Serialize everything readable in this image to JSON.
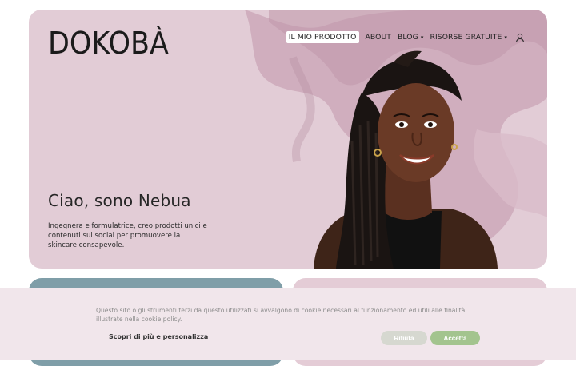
{
  "brand": {
    "logo": "DOKOBÀ"
  },
  "nav": {
    "items": [
      {
        "label": "IL MIO PRODOTTO",
        "active": true,
        "dropdown": false
      },
      {
        "label": "ABOUT",
        "active": false,
        "dropdown": false
      },
      {
        "label": "BLOG",
        "active": false,
        "dropdown": true
      },
      {
        "label": "RISORSE GRATUITE",
        "active": false,
        "dropdown": true
      }
    ],
    "account_icon": "user-icon"
  },
  "hero": {
    "title": "Ciao, sono Nebua",
    "subtitle": "Ingegnera e formulatrice, creo prodotti unici e contenuti sui social per promuovere la skincare consapevole.",
    "background_color": "#e2ccd6",
    "splash_color": "#c7a3b3"
  },
  "cards": [
    {
      "name": "left-card",
      "color": "#7f9ea8"
    },
    {
      "name": "right-card",
      "color": "#e4ccd6"
    }
  ],
  "cookie_banner": {
    "text": "Questo sito o gli strumenti terzi da questo utilizzati si avvalgono di cookie necessari al funzionamento ed utili alle finalità illustrate nella cookie policy.",
    "more_link": "Scopri di più e personalizza",
    "reject_label": "Rifiuta",
    "accept_label": "Accetta",
    "accept_color": "#a3c48e",
    "reject_color": "#d6d8d0"
  }
}
